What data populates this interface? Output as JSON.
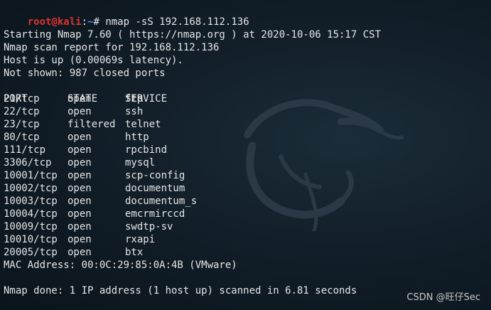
{
  "prompt": {
    "user": "root@kali",
    "separator": ":",
    "path": "~",
    "symbol": "#"
  },
  "command": "nmap -sS 192.168.112.136",
  "output": {
    "start_line": "Starting Nmap 7.60 ( https://nmap.org ) at 2020-10-06 15:17 CST",
    "report_line": "Nmap scan report for 192.168.112.136",
    "host_line": "Host is up (0.00069s latency).",
    "not_shown_line": "Not shown: 987 closed ports",
    "table_header": {
      "port": "PORT",
      "state": "STATE",
      "service": "SERVICE"
    },
    "ports": [
      {
        "port": "21/tcp",
        "state": "open",
        "service": "ftp"
      },
      {
        "port": "22/tcp",
        "state": "open",
        "service": "ssh"
      },
      {
        "port": "23/tcp",
        "state": "filtered",
        "service": "telnet"
      },
      {
        "port": "80/tcp",
        "state": "open",
        "service": "http"
      },
      {
        "port": "111/tcp",
        "state": "open",
        "service": "rpcbind"
      },
      {
        "port": "3306/tcp",
        "state": "open",
        "service": "mysql"
      },
      {
        "port": "10001/tcp",
        "state": "open",
        "service": "scp-config"
      },
      {
        "port": "10002/tcp",
        "state": "open",
        "service": "documentum"
      },
      {
        "port": "10003/tcp",
        "state": "open",
        "service": "documentum_s"
      },
      {
        "port": "10004/tcp",
        "state": "open",
        "service": "emcrmirccd"
      },
      {
        "port": "10009/tcp",
        "state": "open",
        "service": "swdtp-sv"
      },
      {
        "port": "10010/tcp",
        "state": "open",
        "service": "rxapi"
      },
      {
        "port": "20005/tcp",
        "state": "open",
        "service": "btx"
      }
    ],
    "mac_line": "MAC Address: 00:0C:29:85:0A:4B (VMware)",
    "done_line": "Nmap done: 1 IP address (1 host up) scanned in 6.81 seconds"
  },
  "watermark": "CSDN @旺仔Sec",
  "colors": {
    "background": "#101c26",
    "text": "#e6e6e6",
    "prompt_user": "#e0312f",
    "prompt_path": "#4c8ef0"
  },
  "background_icon": "kali-dragon-icon"
}
